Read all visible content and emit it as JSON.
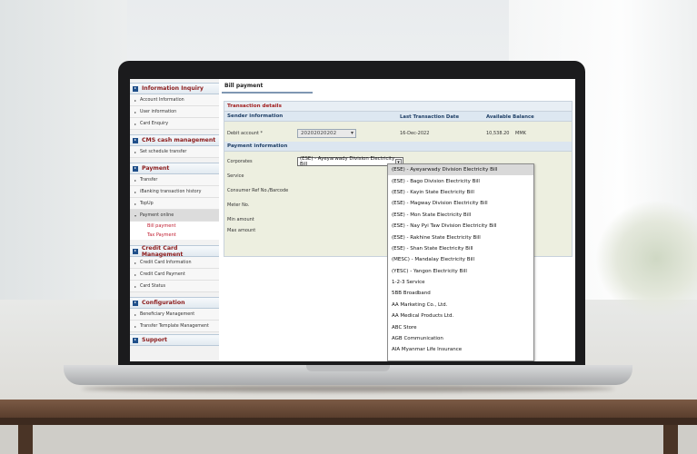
{
  "sidebar": {
    "sections": [
      {
        "title": "Information Inquiry",
        "items": [
          "Account Information",
          "User information",
          "Card Enquiry"
        ]
      },
      {
        "title": "CMS cash management",
        "items": [
          "Set schedule transfer"
        ]
      },
      {
        "title": "Payment",
        "items": [
          "Transfer",
          "iBanking transaction history",
          "TopUp",
          "Payment online"
        ],
        "sub_items": [
          "Bill payment",
          "Tax Payment"
        ]
      },
      {
        "title": "Credit Card Management",
        "items": [
          "Credit Card Information",
          "Credit Card Payment",
          "Card Status"
        ]
      },
      {
        "title": "Configuration",
        "items": [
          "Beneficiary Management",
          "Transfer Template Management"
        ]
      },
      {
        "title": "Support",
        "items": []
      }
    ]
  },
  "main": {
    "page_title": "Bill payment",
    "transaction_details": "Transaction details",
    "sender_information": "Sender information",
    "last_transaction_date_header": "Last Transaction Date",
    "available_balance_header": "Available Balance",
    "debit_account_label": "Debit account *",
    "debit_account_value": "20202020202",
    "last_transaction_date": "16-Dec-2022",
    "available_balance": "10,538.20",
    "currency": "MMK",
    "payment_information": "Payment information",
    "corporates_label": "Corporates",
    "corporates_selected": "(ESE) - Ayeyarwady Division Electricity Bill",
    "service_label": "Service",
    "consumer_ref_label": "Consumer Ref No./Barcode",
    "meter_no_label": "Meter No.",
    "min_amount_label": "Min amount",
    "max_amount_label": "Max amount"
  },
  "dropdown_options": [
    "(ESE) - Ayeyarwady Division Electricity Bill",
    "(ESE) - Bago Division Electricity Bill",
    "(ESE) - Kayin State Electricity Bill",
    "(ESE) - Magway Division Electricity Bill",
    "(ESE) - Mon State Electricity Bill",
    "(ESE) - Nay Pyi Taw Division Electricity Bill",
    "(ESE) - Rakhine State Electricity Bill",
    "(ESE) - Shan State Electricity Bill",
    "(MESC) - Mandalay Electricity Bill",
    "(YESC) - Yangon Electricity Bill",
    "1-2-3 Service",
    "5BB Broadband",
    "AA Marketing Co., Ltd.",
    "AA Medical Products Ltd.",
    "ABC Store",
    "AGB Communication",
    "AIA Myanmar Life Insurance"
  ]
}
